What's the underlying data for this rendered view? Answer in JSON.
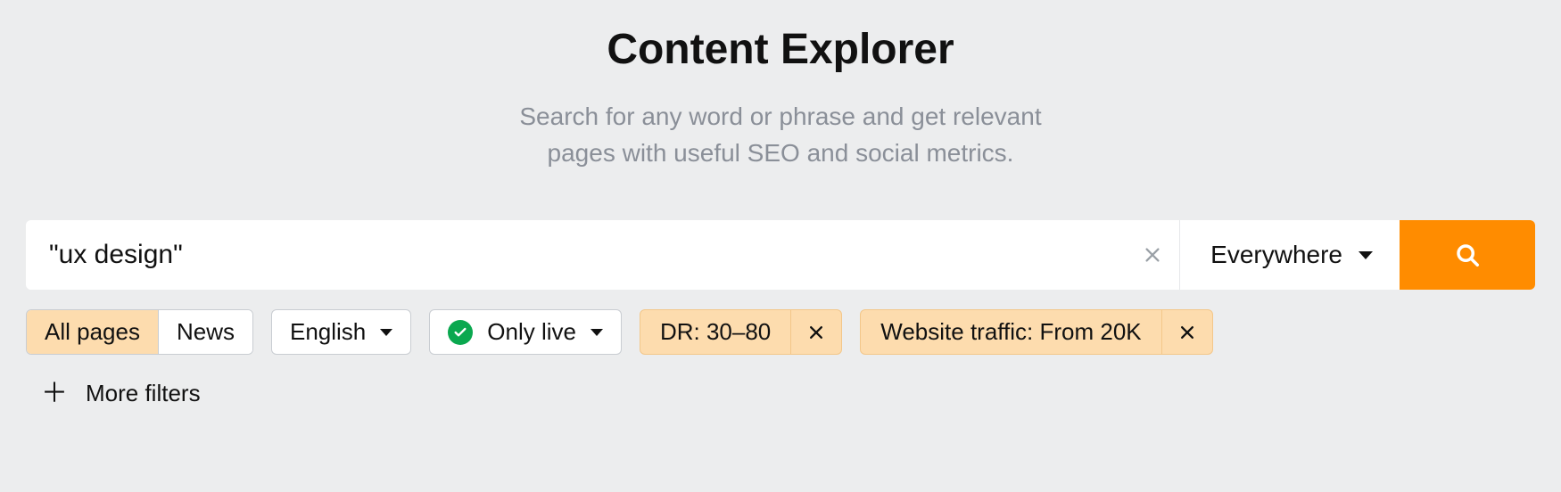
{
  "header": {
    "title": "Content Explorer",
    "subtitle_line1": "Search for any word or phrase and get relevant",
    "subtitle_line2": "pages with useful SEO and social metrics."
  },
  "search": {
    "value": "\"ux design\"",
    "scope": "Everywhere"
  },
  "filters": {
    "page_type": {
      "options": [
        "All pages",
        "News"
      ],
      "active": "All pages"
    },
    "language": "English",
    "live_label": "Only live",
    "chips": [
      {
        "label": "DR: 30–80"
      },
      {
        "label": "Website traffic: From 20K"
      }
    ],
    "more_label": "More filters"
  }
}
